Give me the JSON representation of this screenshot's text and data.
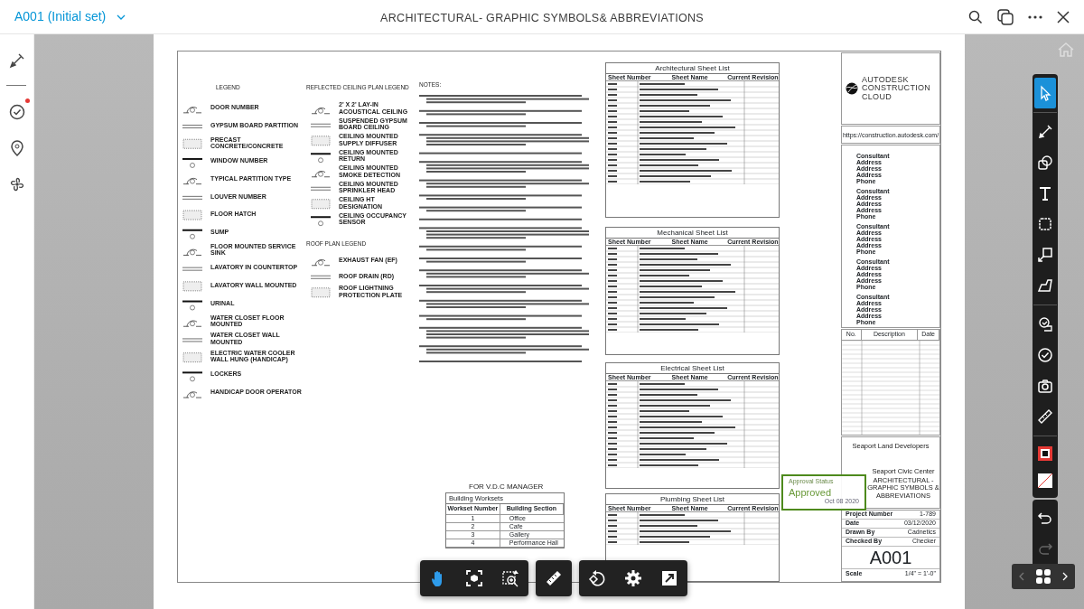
{
  "header": {
    "sheet": "A001",
    "version": "(Initial set)",
    "title": "ARCHITECTURAL- GRAPHIC SYMBOLS& ABBREVIATIONS"
  },
  "left_tools": [
    {
      "kind": "markup",
      "notified": false
    },
    {
      "kind": "issues",
      "notified": true
    },
    {
      "kind": "location",
      "notified": false
    },
    {
      "kind": "fan",
      "notified": false
    }
  ],
  "sheet": {
    "legend": {
      "title": "LEGEND",
      "items": [
        "DOOR NUMBER",
        "GYPSUM BOARD PARTITION",
        "PRECAST CONCRETE/CONCRETE",
        "WINDOW NUMBER",
        "TYPICAL PARTITION TYPE",
        "LOUVER NUMBER",
        "FLOOR HATCH",
        "SUMP",
        "FLOOR MOUNTED SERVICE SINK",
        "LAVATORY IN COUNTERTOP",
        "LAVATORY WALL MOUNTED",
        "URINAL",
        "WATER CLOSET FLOOR MOUNTED",
        "WATER CLOSET WALL MOUNTED",
        "ELECTRIC WATER COOLER WALL HUNG (HANDICAP)",
        "LOCKERS",
        "HANDICAP DOOR OPERATOR"
      ]
    },
    "ceiling_legend": {
      "title": "REFLECTED CEILING PLAN LEGEND",
      "items": [
        "2' X 2' LAY-IN ACOUSTICAL CEILING",
        "SUSPENDED GYPSUM BOARD CEILING",
        "CEILING MOUNTED SUPPLY DIFFUSER",
        "CEILING MOUNTED RETURN",
        "CEILING MOUNTED SMOKE DETECTION",
        "CEILING MOUNTED SPRINKLER HEAD",
        "CEILING HT DESIGNATION",
        "CEILING OCCUPANCY SENSOR"
      ]
    },
    "roof_legend": {
      "title": "ROOF PLAN LEGEND",
      "items": [
        "EXHAUST FAN (EF)",
        "ROOF DRAIN (RD)",
        "ROOF LIGHTNING PROTECTION PLATE"
      ]
    },
    "notes": {
      "title": "NOTES:"
    },
    "vdc": {
      "title": "FOR V.D.C MANAGER",
      "table_title": "Building Worksets",
      "columns": [
        "Workset Number",
        "Building Section"
      ],
      "rows": [
        [
          "1",
          "Office"
        ],
        [
          "2",
          "Cafe"
        ],
        [
          "3",
          "Gallery"
        ],
        [
          "4",
          "Performance Hall"
        ]
      ]
    },
    "sheet_lists": [
      {
        "title": "Architectural Sheet List",
        "columns": [
          "Sheet Number",
          "Sheet Name",
          "Current Revision"
        ]
      },
      {
        "title": "Mechanical Sheet List",
        "columns": [
          "Sheet Number",
          "Sheet Name",
          "Current Revision"
        ]
      },
      {
        "title": "Electrical Sheet List",
        "columns": [
          "Sheet Number",
          "Sheet Name",
          "Current Revision"
        ]
      },
      {
        "title": "Plumbing Sheet List",
        "columns": [
          "Sheet Number",
          "Sheet Name",
          "Current Revision"
        ]
      }
    ],
    "title_block": {
      "logo": [
        "AUTODESK",
        "CONSTRUCTION",
        "CLOUD"
      ],
      "url": "https://construction.autodesk.com/",
      "consultants": [
        [
          "Consultant",
          "Address",
          "Address",
          "Address",
          "Phone"
        ],
        [
          "Consultant",
          "Address",
          "Address",
          "Address",
          "Phone"
        ],
        [
          "Consultant",
          "Address",
          "Address",
          "Address",
          "Phone"
        ],
        [
          "Consultant",
          "Address",
          "Address",
          "Address",
          "Phone"
        ],
        [
          "Consultant",
          "Address",
          "Address",
          "Address",
          "Phone"
        ]
      ],
      "revision_columns": [
        "No.",
        "Description",
        "Date"
      ],
      "owner": "Seaport Land Developers",
      "project": "Seaport Civic Center",
      "sheet_title": "ARCHITECTURAL - GRAPHIC SYMBOLS & ABBREVIATIONS",
      "fields": [
        {
          "label": "Project Number",
          "value": "1-789"
        },
        {
          "label": "Date",
          "value": "03/12/2020"
        },
        {
          "label": "Drawn By",
          "value": "Cadnetics"
        },
        {
          "label": "Checked By",
          "value": "Checker"
        }
      ],
      "sheet_number": "A001",
      "scale": {
        "label": "Scale",
        "value": "1/4\" = 1'-0\""
      }
    }
  },
  "approval": {
    "label": "Approval Status",
    "status": "Approved",
    "date": "Oct 08 2020"
  },
  "right_tools": [
    {
      "kind": "select",
      "selected": true
    },
    {
      "kind": "divider"
    },
    {
      "kind": "pen",
      "selected": false
    },
    {
      "kind": "shapes",
      "selected": false
    },
    {
      "kind": "text",
      "selected": false
    },
    {
      "kind": "cloud",
      "selected": false
    },
    {
      "kind": "callout",
      "selected": false
    },
    {
      "kind": "area",
      "selected": false
    },
    {
      "kind": "divider"
    },
    {
      "kind": "stamp",
      "selected": false
    },
    {
      "kind": "check",
      "selected": false
    },
    {
      "kind": "camera",
      "selected": false
    },
    {
      "kind": "measure",
      "selected": false
    },
    {
      "kind": "divider"
    },
    {
      "kind": "stroke",
      "color": "#e53935"
    },
    {
      "kind": "fill"
    }
  ],
  "history": [
    {
      "kind": "undo",
      "disabled": false
    },
    {
      "kind": "redo",
      "disabled": true
    }
  ],
  "pager": {
    "prev_disabled": true,
    "next_disabled": false
  },
  "view_tools": [
    [
      {
        "kind": "pan",
        "selected": true
      },
      {
        "kind": "fit",
        "selected": false
      },
      {
        "kind": "zoom-window",
        "selected": false
      }
    ],
    [
      {
        "kind": "measure",
        "selected": false
      }
    ],
    [
      {
        "kind": "rotate",
        "selected": false
      },
      {
        "kind": "settings",
        "selected": false
      },
      {
        "kind": "fullscreen",
        "selected": false
      }
    ]
  ]
}
